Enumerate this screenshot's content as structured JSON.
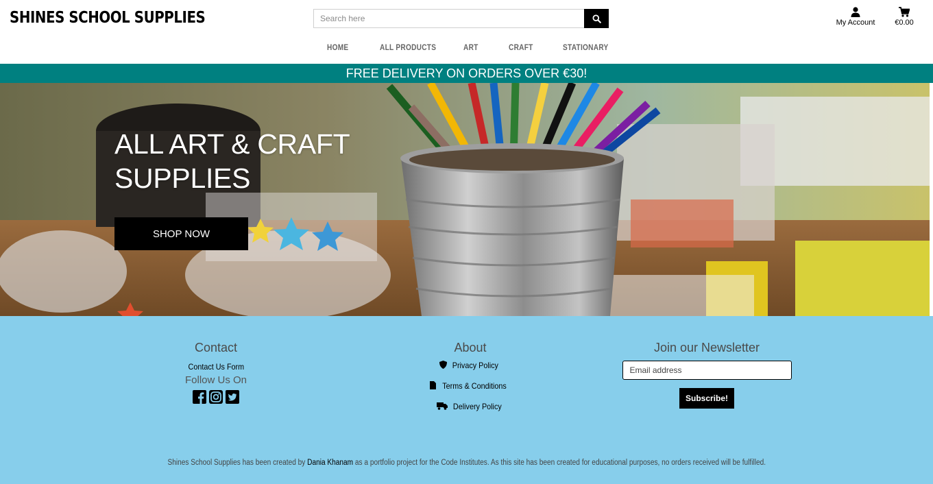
{
  "header": {
    "logo": "SHINES SCHOOL SUPPLIES",
    "search_placeholder": "Search here",
    "account_label": "My Account",
    "bag_total": "€0.00"
  },
  "nav": {
    "items": [
      "HOME",
      "ALL PRODUCTS",
      "ART",
      "CRAFT",
      "STATIONARY"
    ]
  },
  "banner": {
    "text": "FREE DELIVERY ON ORDERS OVER €30!",
    "color": "#008080"
  },
  "hero": {
    "title_line1": "ALL ART & CRAFT",
    "title_line2": "SUPPLIES",
    "button": "SHOP NOW"
  },
  "footer": {
    "background": "#87ceeb",
    "contact": {
      "heading": "Contact",
      "link": "Contact Us Form",
      "follow": "Follow Us On",
      "social_icons": [
        "facebook-icon",
        "instagram-icon",
        "twitter-icon"
      ]
    },
    "about": {
      "heading": "About",
      "links": [
        {
          "icon": "shield-icon",
          "label": "Privacy Policy"
        },
        {
          "icon": "file-icon",
          "label": "Terms & Conditions"
        },
        {
          "icon": "truck-icon",
          "label": "Delivery Policy"
        }
      ]
    },
    "newsletter": {
      "heading": "Join our Newsletter",
      "email_placeholder": "Email address",
      "button": "Subscribe!"
    },
    "credit": {
      "before": "Shines School Supplies has been created by ",
      "author": "Dania Khanam",
      "after": " as a portfolio project for the Code Institutes. As this site has been created for educational purposes, no orders received will be fulfilled."
    }
  }
}
